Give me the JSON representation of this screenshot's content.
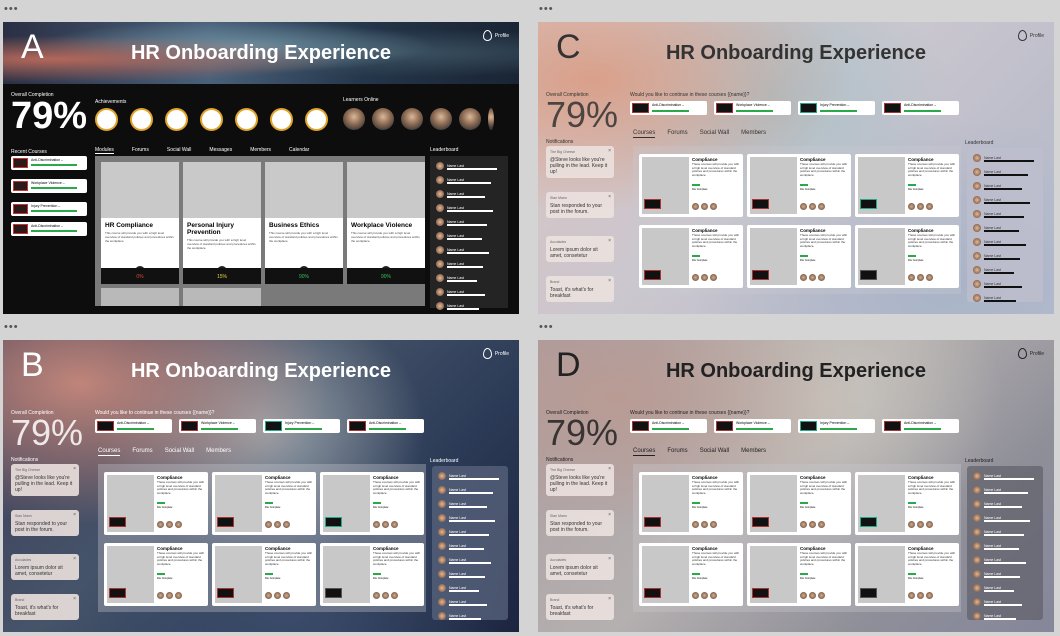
{
  "app_title": "HR Onboarding Experience",
  "profile_label": "Profile",
  "variants": {
    "A": {
      "letter": "A",
      "overall_label": "Overall Completion",
      "overall_value": "79%",
      "achievements_label": "Achievements",
      "learners_label": "Learners Online",
      "recent_label": "Recent Courses",
      "recent_courses": [
        "Anti-Discrimination –",
        "Workplace Violence –",
        "Injury Prevention –",
        "Anti-Discrimination –"
      ],
      "tabs": [
        "Modules",
        "Forums",
        "Social Wall",
        "Messages",
        "Members",
        "Calendar"
      ],
      "modules": [
        {
          "title": "HR Compliance",
          "desc": "This course will provide you with a high level overview of standard policies and procedures within the workplace.",
          "pct": "0%"
        },
        {
          "title": "Personal Injury Prevention",
          "desc": "This course will provide you with a high level overview of standard policies and procedures within the workplace.",
          "pct": "15%"
        },
        {
          "title": "Business Ethics",
          "desc": "This course will provide you with a high level overview of standard policies and procedures within the workplace.",
          "pct": "90%"
        },
        {
          "title": "Workplace Violence",
          "desc": "This course will provide you with a high level overview of standard policies and procedures within the workplace.",
          "pct": "90%"
        }
      ],
      "leaderboard_label": "Leaderboard",
      "leader_name": "Name Last"
    },
    "shared": {
      "overall_label": "Overall Completion",
      "overall_value": "79%",
      "continue_q": "Would you like to continue in these courses {{name}}?",
      "mini_courses": [
        "Anti-Discrimination –",
        "Workplace Violence –",
        "Injury Prevention –",
        "Anti-Discrimination –"
      ],
      "tabs": [
        "Courses",
        "Forums",
        "Social Wall",
        "Members"
      ],
      "notifications_label": "Notifications",
      "notifications": [
        {
          "from": "The Big Cheese",
          "text": "@Steve looks like you're pulling in the lead. Keep it up!"
        },
        {
          "from": "Stan Mann",
          "text": "Stan responded to your post in the forum."
        },
        {
          "from": "Accolades",
          "text": "Lorem ipsum dolor sit amet, consetetur"
        },
        {
          "from": "Brand",
          "text": "Toast, it's what's for breakfast"
        }
      ],
      "course_title": "Compliance",
      "course_desc": "These courses will provide you with a high level overview of standard policies and procedures within the workplace.",
      "course_meta": "File Complete",
      "leaderboard_label": "Leaderboard",
      "leader_name": "Name Last"
    },
    "letters": [
      "B",
      "C",
      "D"
    ]
  }
}
